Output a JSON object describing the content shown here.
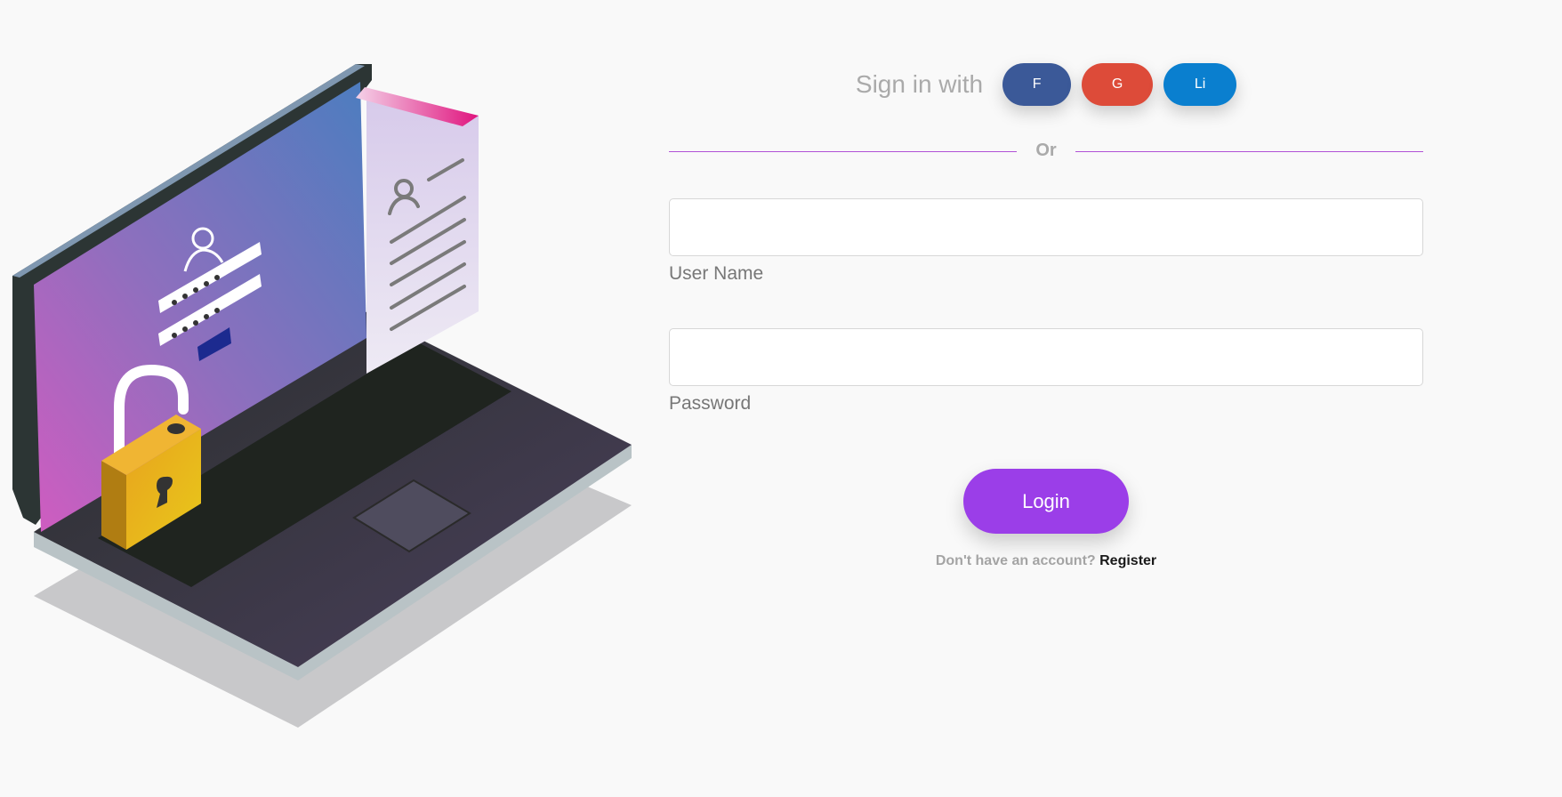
{
  "social": {
    "label": "Sign in with",
    "buttons": [
      {
        "label": "F",
        "color": "#3b5998"
      },
      {
        "label": "G",
        "color": "#dd4b39"
      },
      {
        "label": "Li",
        "color": "#0a7fcf"
      }
    ]
  },
  "divider": {
    "label": "Or"
  },
  "form": {
    "username": {
      "label": "User Name",
      "value": ""
    },
    "password": {
      "label": "Password",
      "value": ""
    },
    "login_label": "Login"
  },
  "register": {
    "prompt": "Don't have an account?",
    "link_label": "Register"
  },
  "colors": {
    "accent": "#9b3ee8",
    "background": "#f9f9f9",
    "padlock": "#e8b41e"
  },
  "illustration": {
    "icons": [
      "laptop-icon",
      "padlock-icon",
      "user-profile-icon",
      "document-icon"
    ]
  }
}
